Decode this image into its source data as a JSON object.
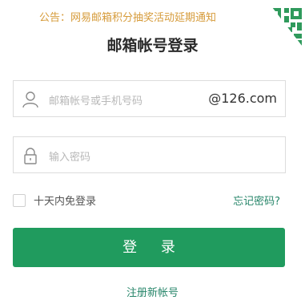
{
  "notice": {
    "text": "公告：网易邮箱积分抽奖活动延期通知"
  },
  "qr_corner": {
    "icon": "qr-code-icon",
    "color": "#2f9a5c"
  },
  "title": "邮箱帐号登录",
  "account_field": {
    "placeholder": "邮箱帐号或手机号码",
    "value": "",
    "suffix": "@126.com",
    "icon": "user-icon"
  },
  "password_field": {
    "placeholder": "输入密码",
    "value": "",
    "icon": "lock-icon"
  },
  "remember": {
    "label": "十天内免登录",
    "checked": false
  },
  "forgot_password": "忘记密码?",
  "login_button": "登 录",
  "register_link": "注册新帐号",
  "colors": {
    "accent": "#209b5e",
    "link": "#27866a",
    "notice": "#d69b3a"
  }
}
